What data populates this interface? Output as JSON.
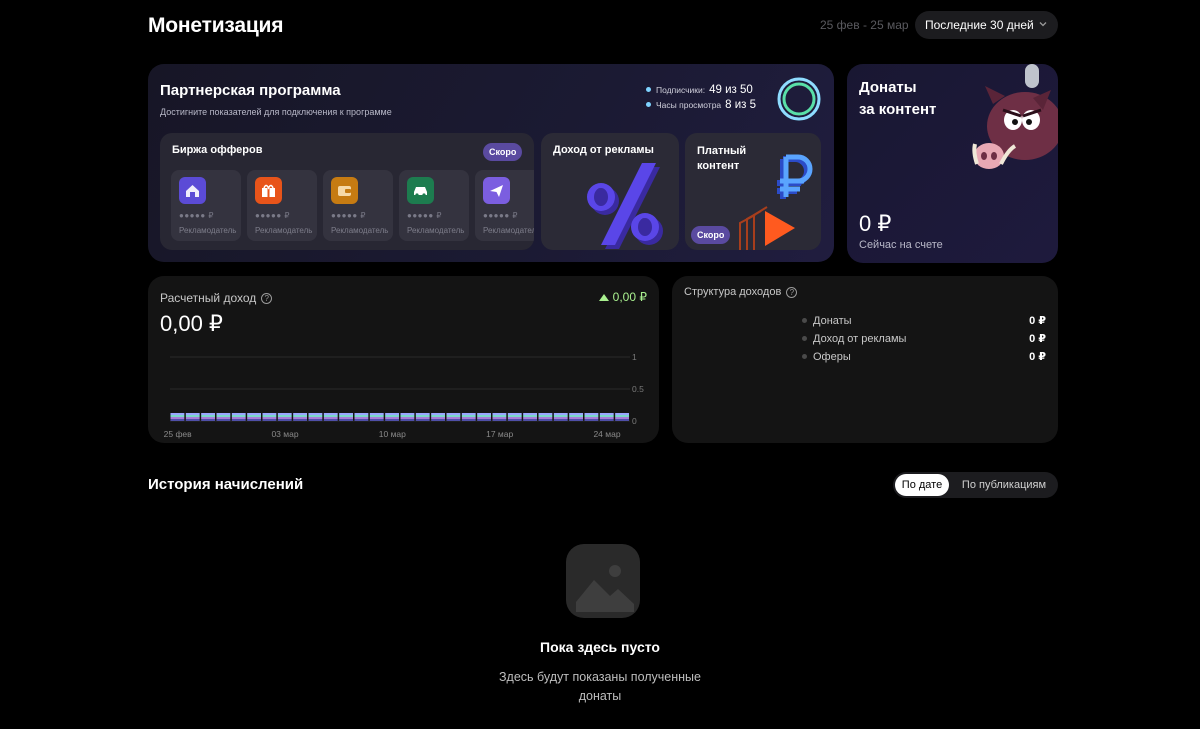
{
  "header": {
    "title": "Монетизация",
    "date_range": "25 фев - 25 мар",
    "period": "Последние 30 дней"
  },
  "partner": {
    "title": "Партнерская программа",
    "subtitle": "Достигните показателей для подключения к программе",
    "stats": [
      {
        "label": "Подписчики:",
        "value": "49 из 50"
      },
      {
        "label": "Часы просмотра",
        "value": "8 из 5"
      }
    ],
    "progress": 0.98,
    "offers": {
      "title": "Биржа офферов",
      "badge": "Скоро",
      "items": [
        {
          "icon": "house-icon",
          "color": "#5b4bd6",
          "stars": "●●●●● ₽",
          "label": "Рекламодатель"
        },
        {
          "icon": "gift-icon",
          "color": "#e8541a",
          "stars": "●●●●● ₽",
          "label": "Рекламодатель"
        },
        {
          "icon": "wallet-icon",
          "color": "#c67b12",
          "stars": "●●●●● ₽",
          "label": "Рекламодатель"
        },
        {
          "icon": "car-icon",
          "color": "#1d7c4f",
          "stars": "●●●●● ₽",
          "label": "Рекламодатель"
        },
        {
          "icon": "plane-icon",
          "color": "#7b5ee0",
          "stars": "●●●●● ₽",
          "label": "Рекламодатель"
        }
      ]
    },
    "ads": {
      "title": "Доход от рекламы"
    },
    "paid": {
      "title_line1": "Платный",
      "title_line2": "контент",
      "badge": "Скоро"
    }
  },
  "donates": {
    "title_line1": "Донаты",
    "title_line2": "за контент",
    "amount": "0 ₽",
    "caption": "Сейчас на счете"
  },
  "income": {
    "title": "Расчетный доход",
    "amount": "0,00 ₽",
    "delta": "0,00 ₽",
    "chart_data": {
      "type": "bar",
      "x_ticks": [
        "25 фев",
        "03 мар",
        "10 мар",
        "17 мар",
        "24 мар"
      ],
      "y_ticks": [
        "1",
        "0.5",
        "0"
      ],
      "ylim": [
        0,
        1
      ],
      "bar_count": 30,
      "values": [
        0,
        0,
        0,
        0,
        0,
        0,
        0,
        0,
        0,
        0,
        0,
        0,
        0,
        0,
        0,
        0,
        0,
        0,
        0,
        0,
        0,
        0,
        0,
        0,
        0,
        0,
        0,
        0,
        0,
        0
      ]
    }
  },
  "structure": {
    "title": "Структура доходов",
    "rows": [
      {
        "label": "Донаты",
        "value": "0 ₽"
      },
      {
        "label": "Доход от рекламы",
        "value": "0 ₽"
      },
      {
        "label": "Оферы",
        "value": "0 ₽"
      }
    ]
  },
  "history": {
    "title": "История начислений",
    "tab_active": "По дате",
    "tab_other": "По публикациям",
    "empty_title": "Пока здесь пусто",
    "empty_text": "Здесь будут показаны полученные донаты"
  }
}
